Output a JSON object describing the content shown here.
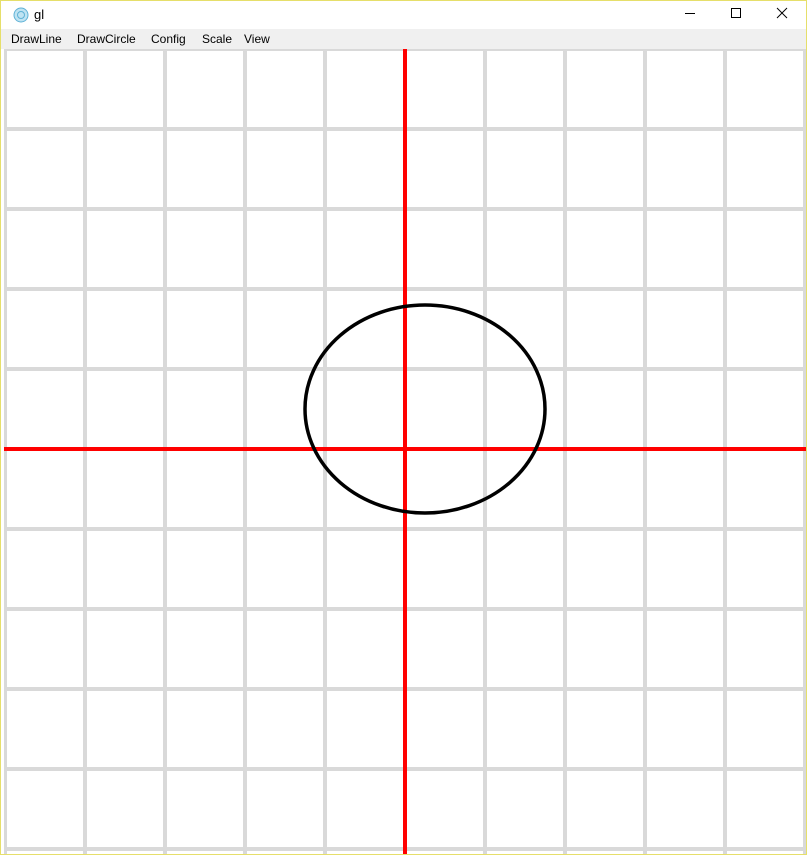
{
  "window": {
    "title": "gl",
    "icons": {
      "app": "opengl-app-icon",
      "minimize": "minimize-icon",
      "maximize": "maximize-icon",
      "close": "close-icon"
    }
  },
  "menu": {
    "items": [
      "DrawLine",
      "DrawCircle",
      "Config",
      "Scale",
      "View"
    ]
  },
  "canvas": {
    "grid_divisions": 10,
    "colors": {
      "background": "#ffffff",
      "grid": "#d9d9d9",
      "axes": "#ff0000",
      "shape": "#000000"
    },
    "shape": {
      "type": "circle",
      "center_cell": [
        0.25,
        0.5
      ],
      "radius_x_cells": 1.5,
      "radius_y_cells": 1.3
    }
  }
}
